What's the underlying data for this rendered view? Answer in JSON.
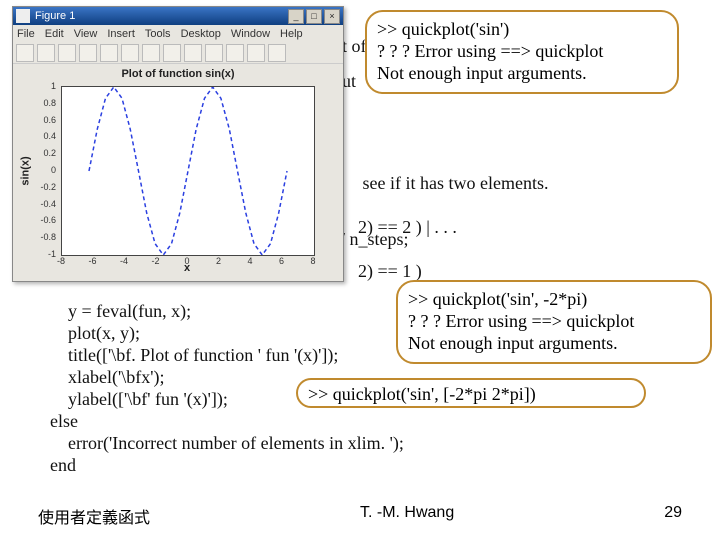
{
  "figure_window": {
    "title": "Figure 1",
    "win_buttons": {
      "min": "_",
      "max": "□",
      "close": "×"
    },
    "menus": [
      "File",
      "Edit",
      "View",
      "Insert",
      "Tools",
      "Desktop",
      "Window",
      "Help"
    ],
    "plot": {
      "title": "Plot of function sin(x)",
      "ylabel": "sin(x)",
      "xlabel": "x"
    }
  },
  "chart_data": {
    "type": "line",
    "title": "Plot of function sin(x)",
    "xlabel": "x",
    "ylabel": "sin(x)",
    "xlim": [
      -8,
      8
    ],
    "ylim": [
      -1,
      1
    ],
    "xticks": [
      -8,
      -6,
      -4,
      -2,
      0,
      2,
      4,
      6,
      8
    ],
    "yticks": [
      -1,
      -0.8,
      -0.6,
      -0.4,
      -0.2,
      0,
      0.2,
      0.4,
      0.6,
      0.8,
      1
    ],
    "x": [
      -6.283,
      -5.76,
      -5.24,
      -4.71,
      -4.19,
      -3.67,
      -3.14,
      -2.62,
      -2.09,
      -1.57,
      -1.05,
      -0.52,
      0,
      0.52,
      1.05,
      1.57,
      2.09,
      2.62,
      3.14,
      3.67,
      4.19,
      4.71,
      5.24,
      5.76,
      6.283
    ],
    "y": [
      0,
      0.5,
      0.866,
      1,
      0.866,
      0.5,
      0,
      -0.5,
      -0.866,
      -1,
      -0.866,
      -0.5,
      0,
      0.5,
      0.866,
      1,
      0.866,
      0.5,
      0,
      -0.5,
      -0.866,
      -1,
      -0.866,
      -0.5,
      0
    ],
    "style": {
      "color": "#2a3fe0",
      "dashed": true
    }
  },
  "callouts": {
    "c1": {
      "l1": ">> quickplot('sin')",
      "l2": "? ? ? Error using ==> quickplot",
      "l3": "Not enough input arguments."
    },
    "c2": {
      "l1": ">> quickplot('sin', -2*pi)",
      "l2": "? ? ? Error using ==> quickplot",
      "l3": "Not enough input arguments."
    },
    "c3": {
      "l1": ">> quickplot('sin', [-2*pi 2*pi])"
    }
  },
  "occluded": {
    "of": "t of",
    "ut": "ut",
    "mid1": " see if it has two elements.",
    "mid2": "2) == 2 ) | . . .",
    "mid3": "2) == 1 )",
    "nsteps": "/ n_steps;"
  },
  "code": {
    "l1": "    y = feval(fun, x);",
    "l2": "    plot(x, y);",
    "l3": "    title(['\\bf. Plot of function ' fun '(x)']);",
    "l4": "    xlabel('\\bfx');",
    "l5": "    ylabel(['\\bf' fun '(x)']);",
    "l6": "else",
    "l7": "    error('Incorrect number of elements in xlim. ');",
    "l8": "end"
  },
  "footer": {
    "left": "使用者定義函式",
    "center": "T. -M. Hwang",
    "right": "29"
  }
}
